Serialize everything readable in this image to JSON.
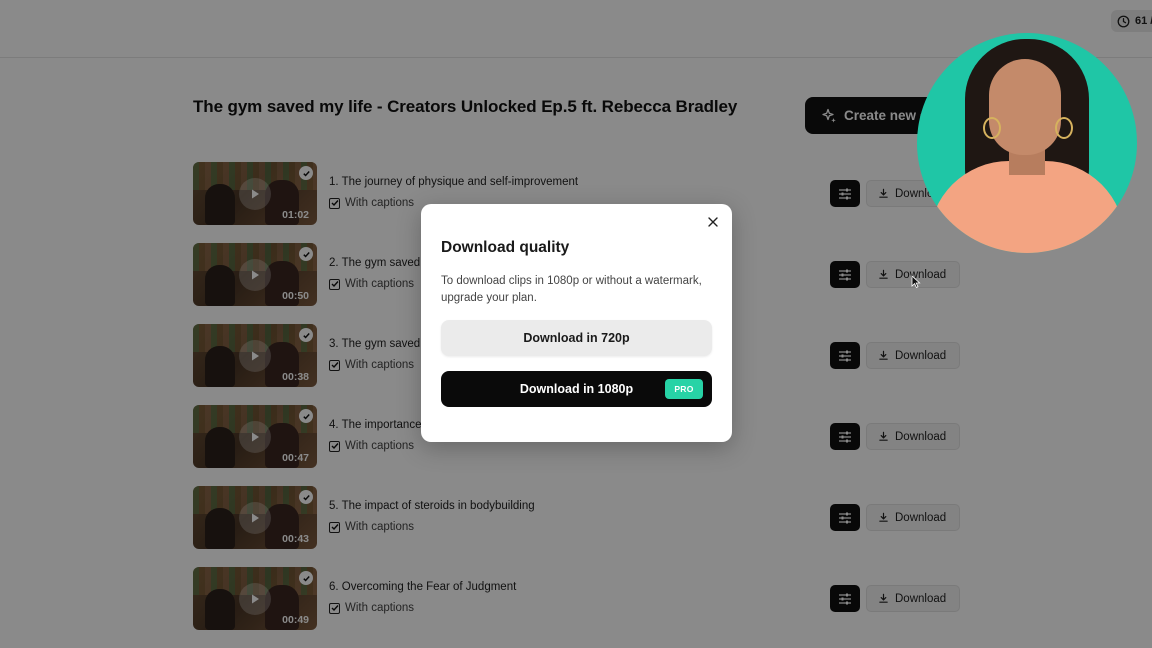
{
  "header": {
    "credits_text": "61 /"
  },
  "page": {
    "title": "The gym saved my life - Creators Unlocked Ep.5 ft. Rebecca Bradley",
    "create_button_label": "Create new c"
  },
  "clips": [
    {
      "title": "1. The journey of physique and self-improvement",
      "duration": "01:02",
      "captions_label": "With captions",
      "download_label": "Download"
    },
    {
      "title": "2. The gym saved",
      "duration": "00:50",
      "captions_label": "With captions",
      "download_label": "Download"
    },
    {
      "title": "3. The gym saved",
      "duration": "00:38",
      "captions_label": "With captions",
      "download_label": "Download"
    },
    {
      "title": "4. The importance",
      "duration": "00:47",
      "captions_label": "With captions",
      "download_label": "Download"
    },
    {
      "title": "5. The impact of steroids in bodybuilding",
      "duration": "00:43",
      "captions_label": "With captions",
      "download_label": "Download"
    },
    {
      "title": "6. Overcoming the Fear of Judgment",
      "duration": "00:49",
      "captions_label": "With captions",
      "download_label": "Download"
    }
  ],
  "modal": {
    "title": "Download quality",
    "description": "To download clips in 1080p or without a watermark, upgrade your plan.",
    "option_720_label": "Download in 720p",
    "option_1080_label": "Download in 1080p",
    "pro_badge": "PRO"
  },
  "colors": {
    "accent_pro": "#27d3a6",
    "primary_dark": "#0a0a0a",
    "webcam_bg": "#1fc6a6"
  }
}
